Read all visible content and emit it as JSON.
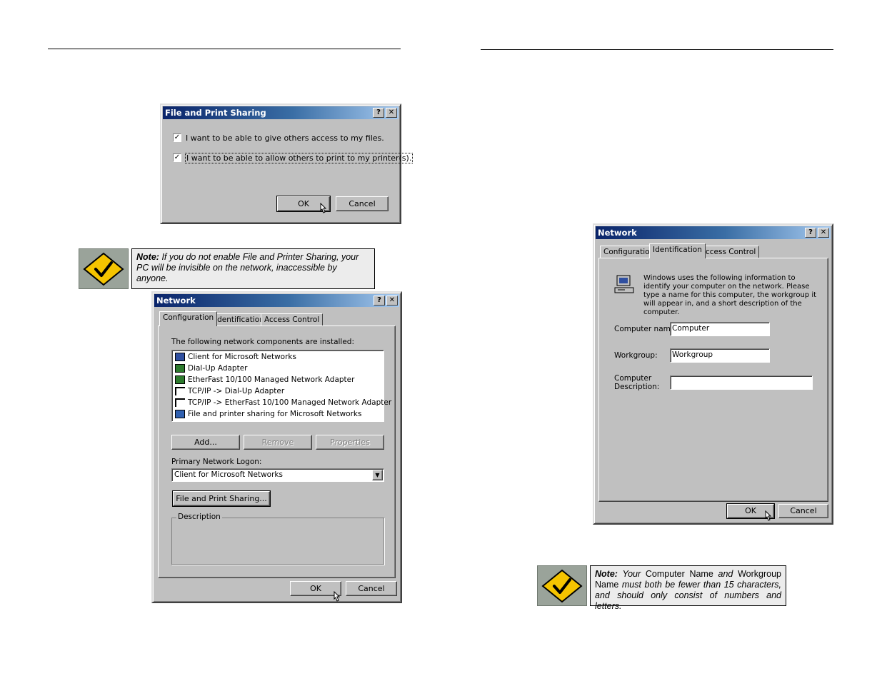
{
  "file_print_dialog": {
    "title": "File and Print Sharing",
    "help": "?",
    "close": "✕",
    "option1": "I want to be able to give others access to my files.",
    "option2": "I want to be able to allow others to print to my printer(s).",
    "ok": "OK",
    "cancel": "Cancel"
  },
  "note1": {
    "label": "Note:",
    "text": "If you do not enable File and Printer Sharing, your PC will be invisible on the network, inaccessible by anyone."
  },
  "network_config_dialog": {
    "title": "Network",
    "tabs": [
      "Configuration",
      "Identification",
      "Access Control"
    ],
    "components_label": "The following network components are installed:",
    "components": [
      "Client for Microsoft Networks",
      "Dial-Up Adapter",
      "EtherFast 10/100 Managed Network Adapter",
      "TCP/IP -> Dial-Up Adapter",
      "TCP/IP -> EtherFast 10/100 Managed Network Adapter",
      "File and printer sharing for Microsoft Networks"
    ],
    "add": "Add...",
    "remove": "Remove",
    "properties": "Properties",
    "logon_label": "Primary Network Logon:",
    "logon_value": "Client for Microsoft Networks",
    "sharing_button": "File and Print Sharing...",
    "description_label": "Description",
    "ok": "OK",
    "cancel": "Cancel"
  },
  "network_id_dialog": {
    "title": "Network",
    "tabs": [
      "Configuration",
      "Identification",
      "Access Control"
    ],
    "info": "Windows uses the following information to identify your computer on the network.  Please type a name for this computer, the workgroup it will appear in, and a short description of the computer.",
    "computer_name_label": "Computer name:",
    "computer_name_value": "Computer",
    "workgroup_label": "Workgroup:",
    "workgroup_value": "Workgroup",
    "description_label_1": "Computer",
    "description_label_2": "Description:",
    "description_value": "",
    "ok": "OK",
    "cancel": "Cancel"
  },
  "note2": {
    "label": "Note:",
    "t1": "Your",
    "t2": "Computer Name",
    "t3": "and",
    "t4": "Workgroup Name",
    "t5": "must both be fewer than 15 characters, and should only consist of numbers and letters."
  }
}
